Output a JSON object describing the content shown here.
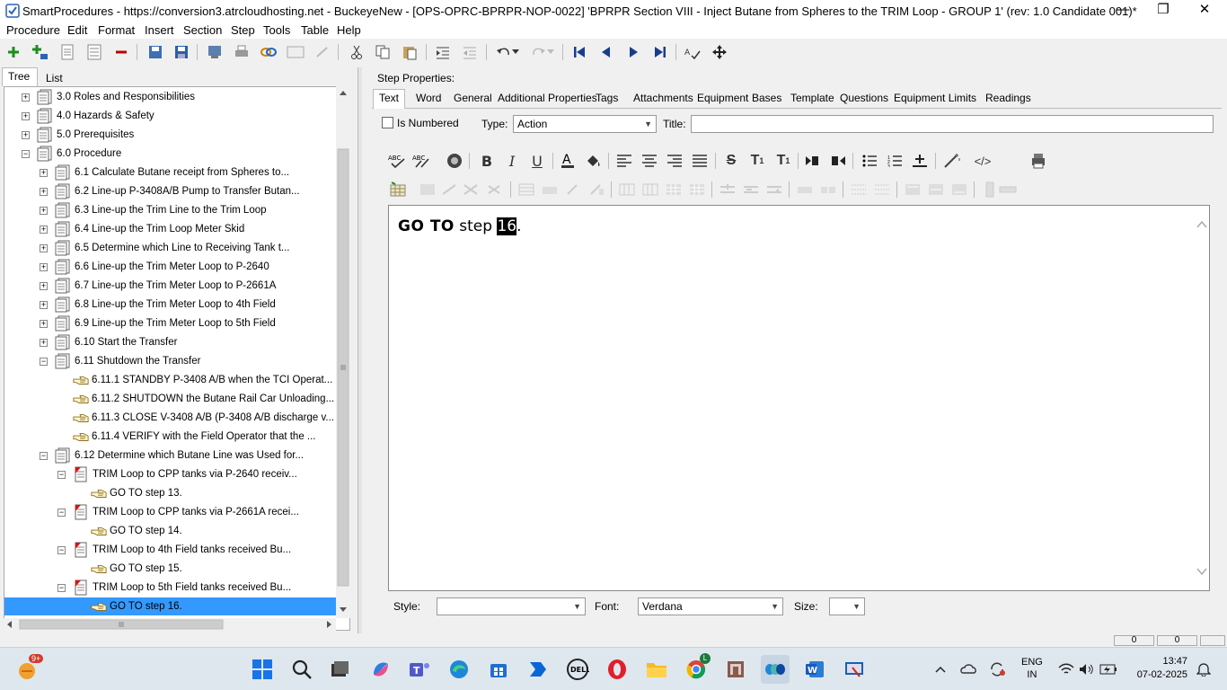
{
  "window": {
    "title": "SmartProcedures - https://conversion3.atrcloudhosting.net - BuckeyeNew - [OPS-OPRC-BPRPR-NOP-0022] 'BPRPR Section VIII - Inject Butane from Spheres to the TRIM Loop - GROUP 1' (rev: 1.0 Candidate 001)*",
    "minimize": "—",
    "maximize": "❐",
    "close": "✕"
  },
  "menu": [
    "Procedure",
    "Edit",
    "Format",
    "Insert",
    "Section",
    "Step",
    "Tools",
    "Table",
    "Help"
  ],
  "left_tabs": [
    "Tree",
    "List"
  ],
  "tree": [
    {
      "label": "3.0 Roles and Responsibilities",
      "level": 0,
      "expander": "+",
      "icon": "section"
    },
    {
      "label": "4.0 Hazards & Safety",
      "level": 0,
      "expander": "+",
      "icon": "section"
    },
    {
      "label": "5.0 Prerequisites",
      "level": 0,
      "expander": "+",
      "icon": "section"
    },
    {
      "label": "6.0 Procedure",
      "level": 0,
      "expander": "−",
      "icon": "section"
    },
    {
      "label": "6.1 Calculate Butane receipt from Spheres to...",
      "level": 1,
      "expander": "+",
      "icon": "section"
    },
    {
      "label": "6.2 Line-up P-3408A/B Pump to Transfer Butan...",
      "level": 1,
      "expander": "+",
      "icon": "section"
    },
    {
      "label": "6.3 Line-up the Trim Line to the Trim Loop",
      "level": 1,
      "expander": "+",
      "icon": "section"
    },
    {
      "label": "6.4 Line-up the Trim Loop Meter Skid",
      "level": 1,
      "expander": "+",
      "icon": "section"
    },
    {
      "label": "6.5 Determine which Line to Receiving Tank t...",
      "level": 1,
      "expander": "+",
      "icon": "section"
    },
    {
      "label": "6.6 Line-up the Trim Meter Loop to P-2640",
      "level": 1,
      "expander": "+",
      "icon": "section"
    },
    {
      "label": "6.7 Line-up the Trim Meter Loop to P-2661A",
      "level": 1,
      "expander": "+",
      "icon": "section"
    },
    {
      "label": "6.8 Line-up the Trim Meter Loop to 4th Field",
      "level": 1,
      "expander": "+",
      "icon": "section"
    },
    {
      "label": "6.9 Line-up the Trim Meter Loop to 5th Field",
      "level": 1,
      "expander": "+",
      "icon": "section"
    },
    {
      "label": "6.10 Start the Transfer",
      "level": 1,
      "expander": "+",
      "icon": "section"
    },
    {
      "label": "6.11 Shutdown the Transfer",
      "level": 1,
      "expander": "−",
      "icon": "section"
    },
    {
      "label": "6.11.1 STANDBY P-3408 A/B when the TCI Operat...",
      "level": 2,
      "expander": "",
      "icon": "hand"
    },
    {
      "label": "6.11.2 SHUTDOWN the Butane Rail Car Unloading...",
      "level": 2,
      "expander": "",
      "icon": "hand"
    },
    {
      "label": "6.11.3 CLOSE V-3408 A/B (P-3408 A/B discharge v...",
      "level": 2,
      "expander": "",
      "icon": "hand"
    },
    {
      "label": "6.11.4 VERIFY with the Field Operator that the ...",
      "level": 2,
      "expander": "",
      "icon": "hand"
    },
    {
      "label": "6.12 Determine which Butane Line was Used for...",
      "level": 1,
      "expander": "−",
      "icon": "section"
    },
    {
      "label": "TRIM Loop to CPP tanks via P-2640 receiv...",
      "level": 2,
      "expander": "−",
      "icon": "decision"
    },
    {
      "label": "GO TO step 13.",
      "level": 3,
      "expander": "",
      "icon": "hand"
    },
    {
      "label": "TRIM Loop to CPP tanks via P-2661A recei...",
      "level": 2,
      "expander": "−",
      "icon": "decision"
    },
    {
      "label": "GO TO step 14.",
      "level": 3,
      "expander": "",
      "icon": "hand"
    },
    {
      "label": "TRIM Loop to 4th Field tanks received Bu...",
      "level": 2,
      "expander": "−",
      "icon": "decision"
    },
    {
      "label": "GO TO step 15.",
      "level": 3,
      "expander": "",
      "icon": "hand"
    },
    {
      "label": "TRIM Loop to 5th Field tanks received Bu...",
      "level": 2,
      "expander": "−",
      "icon": "decision"
    },
    {
      "label": "GO TO step 16.",
      "level": 3,
      "expander": "",
      "icon": "hand",
      "selected": true
    }
  ],
  "step_properties": {
    "heading": "Step Properties:",
    "tabs": [
      "Text",
      "Word",
      "General",
      "Additional Properties",
      "Tags",
      "Attachments",
      "Equipment",
      "Bases",
      "Template",
      "Questions",
      "Equipment Limits",
      "Readings"
    ],
    "active_tab": "Text",
    "is_numbered_label": "Is Numbered",
    "type_label": "Type:",
    "type_value": "Action",
    "title_label": "Title:",
    "title_value": ""
  },
  "editor": {
    "bold_text": "GO TO",
    "plain_text": " step ",
    "highlight_text": "16",
    "trailing": "."
  },
  "bottom": {
    "style_label": "Style:",
    "style_value": "",
    "font_label": "Font:",
    "font_value": "Verdana",
    "size_label": "Size:",
    "size_value": ""
  },
  "status": {
    "cell1": "0",
    "cell2": "0"
  },
  "taskbar": {
    "weather_badge": "9+",
    "lang_line1": "ENG",
    "lang_line2": "IN",
    "time": "13:47",
    "date": "07-02-2025",
    "chrome_badge": "L"
  }
}
